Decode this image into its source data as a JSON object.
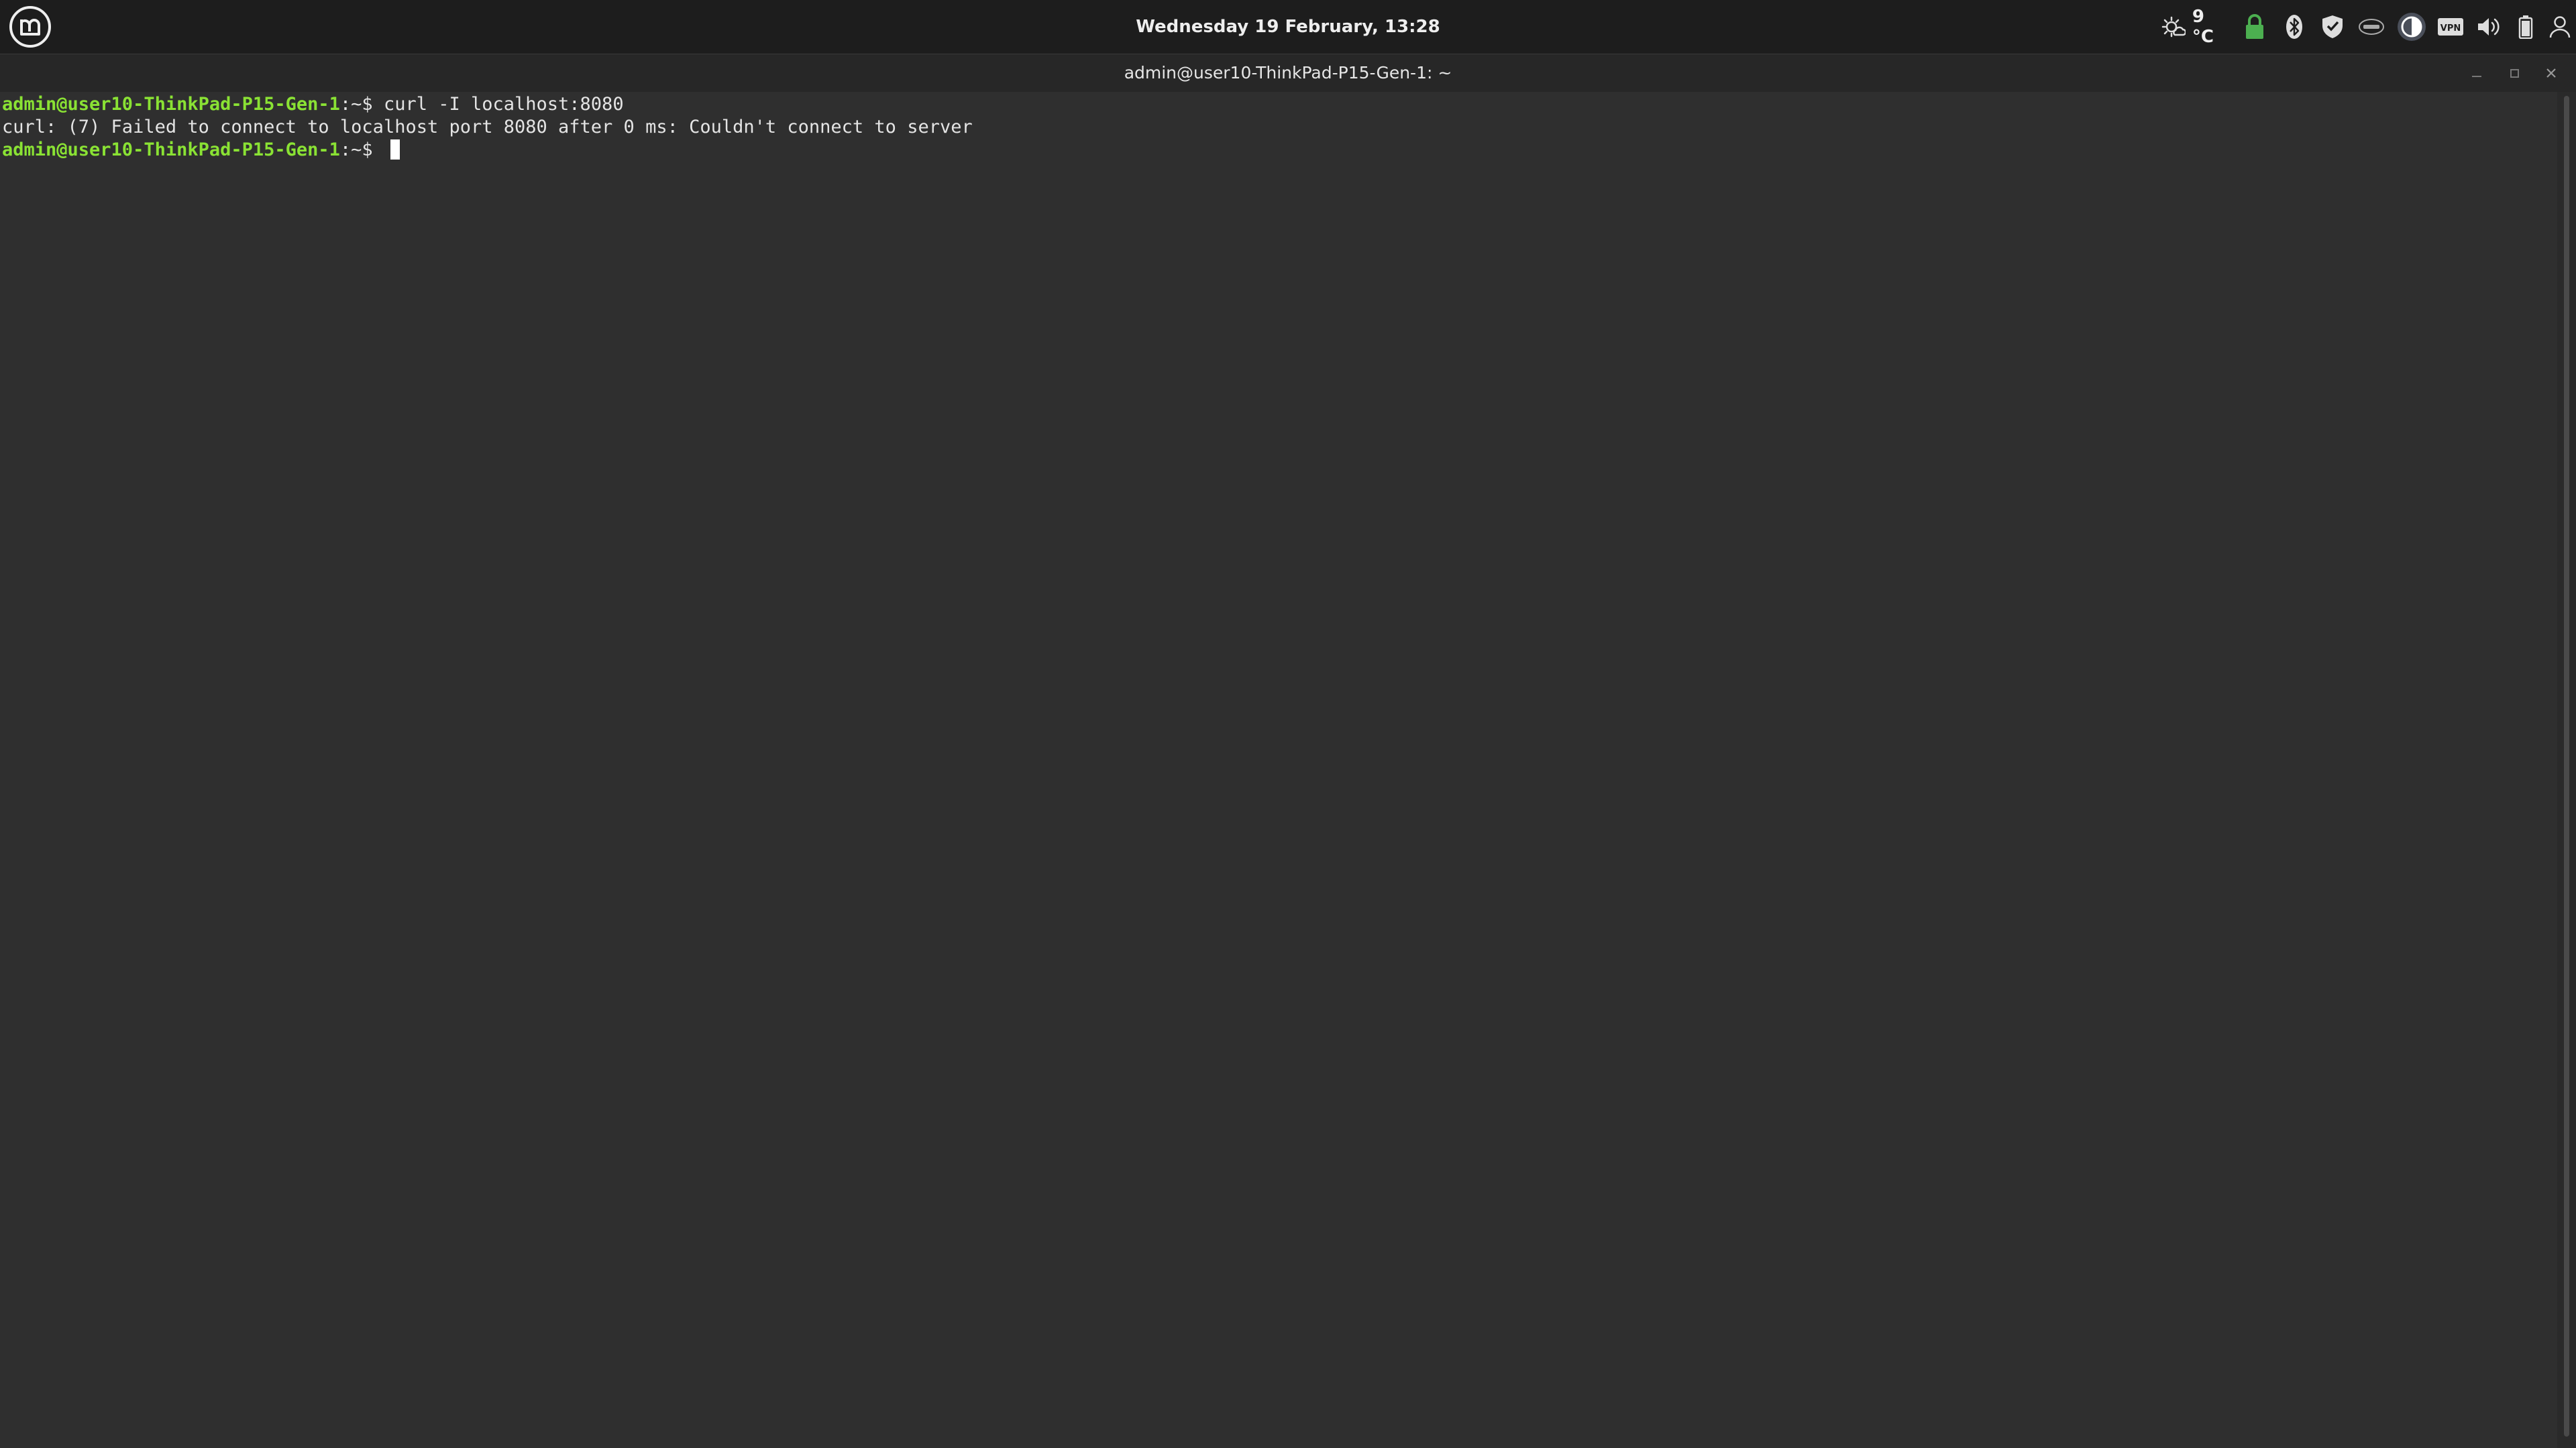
{
  "topbar": {
    "clock": "Wednesday 19 February, 13:28",
    "weather_temp": "9 °C",
    "icons": [
      "menu-icon",
      "weather-icon",
      "lock-icon",
      "bluetooth-icon",
      "shield-icon",
      "intel-icon",
      "accessibility-icon",
      "vpn-icon",
      "volume-icon",
      "battery-icon",
      "user-icon"
    ],
    "accent": "#4caf50"
  },
  "window": {
    "title": "admin@user10-ThinkPad-P15-Gen-1: ~"
  },
  "terminal": {
    "lines": [
      {
        "prompt": "admin@user10-ThinkPad-P15-Gen-1",
        "suffix": ":~$ ",
        "command": "curl -I localhost:8080"
      },
      {
        "output": "curl: (7) Failed to connect to localhost port 8080 after 0 ms: Couldn't connect to server"
      },
      {
        "prompt": "admin@user10-ThinkPad-P15-Gen-1",
        "suffix": ":~$ ",
        "command": ""
      }
    ]
  }
}
